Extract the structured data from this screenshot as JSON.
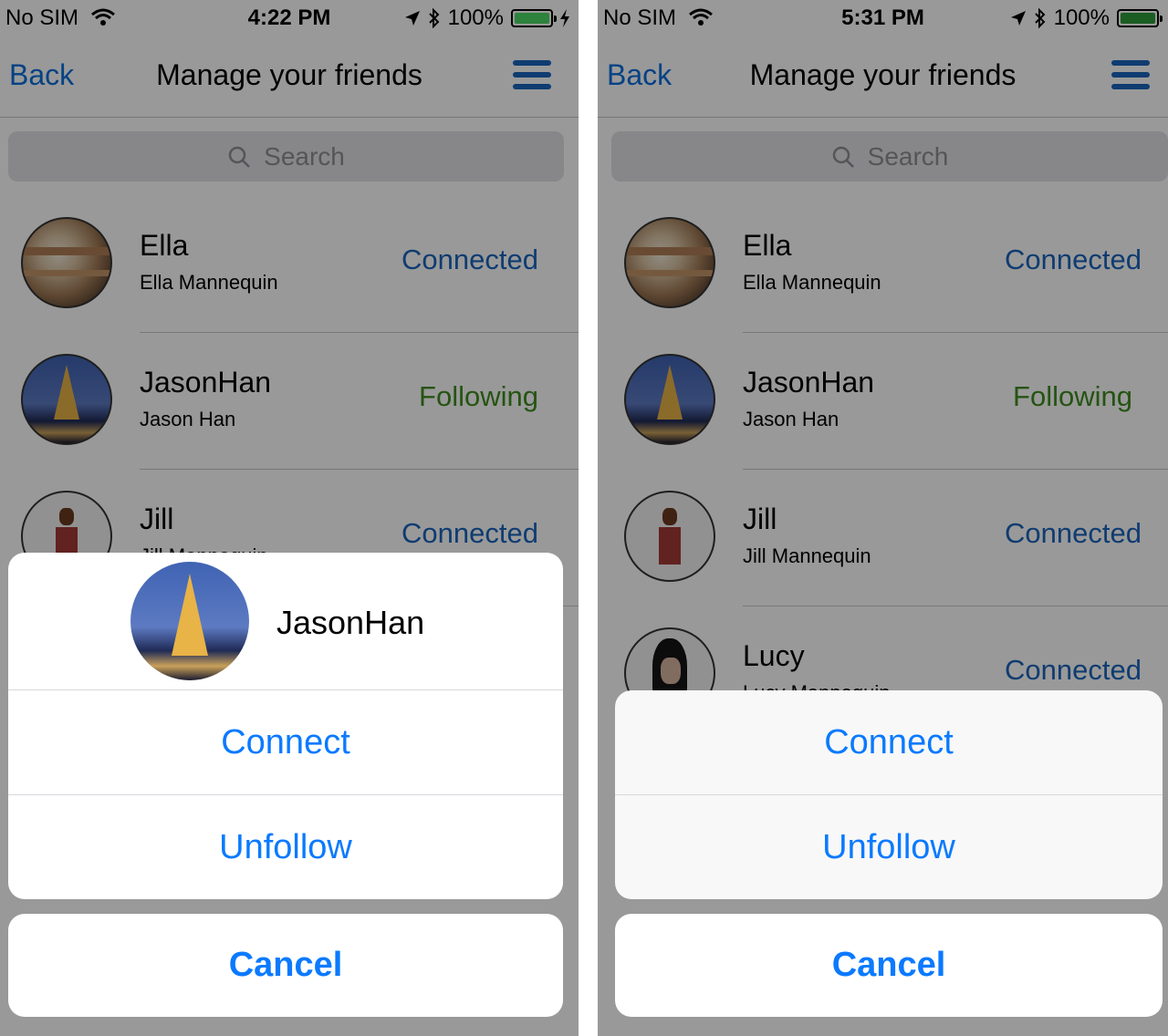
{
  "screens": [
    {
      "status": {
        "carrier": "No SIM",
        "time": "4:22 PM",
        "battery": "100%"
      },
      "nav": {
        "back": "Back",
        "title": "Manage your friends"
      },
      "search": {
        "placeholder": "Search"
      },
      "friends": [
        {
          "username": "Ella",
          "fullname": "Ella Mannequin",
          "status": "Connected"
        },
        {
          "username": "JasonHan",
          "fullname": "Jason Han",
          "status": "Following"
        },
        {
          "username": "Jill",
          "fullname": "Jill Mannequin",
          "status": "Connected"
        }
      ],
      "sheet": {
        "name": "JasonHan",
        "connect": "Connect",
        "unfollow": "Unfollow",
        "cancel": "Cancel"
      }
    },
    {
      "status": {
        "carrier": "No SIM",
        "time": "5:31 PM",
        "battery": "100%"
      },
      "nav": {
        "back": "Back",
        "title": "Manage your friends"
      },
      "search": {
        "placeholder": "Search"
      },
      "friends": [
        {
          "username": "Ella",
          "fullname": "Ella Mannequin",
          "status": "Connected"
        },
        {
          "username": "JasonHan",
          "fullname": "Jason Han",
          "status": "Following"
        },
        {
          "username": "Jill",
          "fullname": "Jill Mannequin",
          "status": "Connected"
        },
        {
          "username": "Lucy",
          "fullname": "Lucy Mannequin",
          "status": "Connected"
        }
      ],
      "sheet": {
        "connect": "Connect",
        "unfollow": "Unfollow",
        "cancel": "Cancel"
      }
    }
  ],
  "colors": {
    "link_blue": "#0a7aff",
    "connected_blue": "#1a64bd",
    "following_green": "#3e8c1e",
    "battery_green": "#4cd964"
  },
  "icons": [
    "wifi-icon",
    "location-arrow-icon",
    "bluetooth-icon",
    "battery-icon",
    "charging-bolt-icon",
    "menu-icon",
    "search-icon"
  ]
}
